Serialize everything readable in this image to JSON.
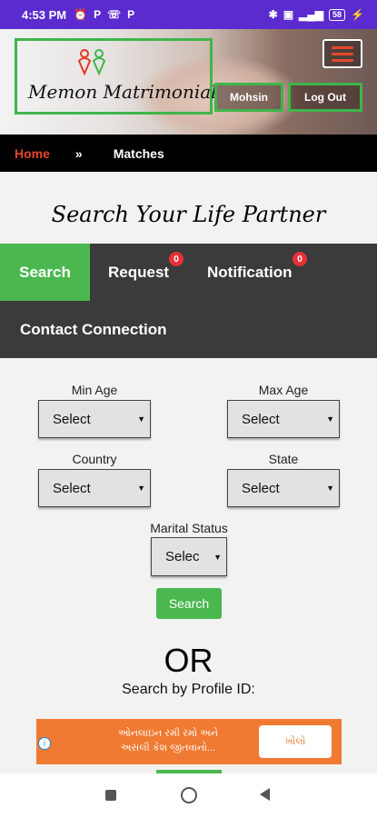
{
  "status_bar": {
    "time": "4:53 PM",
    "left_icons": [
      "alarm-icon",
      "paytm-icon",
      "whatsapp-icon",
      "paytm-icon"
    ],
    "left_icon_glyphs": [
      "⏰",
      "P",
      "☏",
      "P"
    ],
    "right_icons": [
      "bluetooth-icon",
      "data-icon",
      "signal-icon",
      "battery-icon",
      "charging-icon"
    ],
    "battery": "58"
  },
  "header": {
    "logo_text": "Memon Matrimonial",
    "user_button": "Mohsin",
    "logout_button": "Log Out",
    "menu_icon": "hamburger-icon"
  },
  "breadcrumb": {
    "home": "Home",
    "separator": "»",
    "current": "Matches"
  },
  "page_title": "Search Your Life Partner",
  "tabs": {
    "search": "Search",
    "request": "Request",
    "request_badge": "0",
    "notification": "Notification",
    "notification_badge": "0",
    "contact": "Contact Connection"
  },
  "form": {
    "min_age_label": "Min Age",
    "min_age_value": "Select",
    "max_age_label": "Max Age",
    "max_age_value": "Select",
    "country_label": "Country",
    "country_value": "Select",
    "state_label": "State",
    "state_value": "Select",
    "marital_label": "Marital Status",
    "marital_value": "Selec",
    "search_button": "Search"
  },
  "or_text": "OR",
  "search_by_id": "Search by Profile ID:",
  "ad": {
    "line1": "ઓનલાઇન રમી રમો અને",
    "line2": "અસલી કેશ જીતવાનો...",
    "button": "ખોલો",
    "info_icon": "info-icon"
  },
  "colors": {
    "status_bar": "#5b2bd0",
    "accent_green": "#4ab84f",
    "home_red": "#e8432a",
    "badge_red": "#e8303a",
    "ad_orange": "#f07a32"
  }
}
